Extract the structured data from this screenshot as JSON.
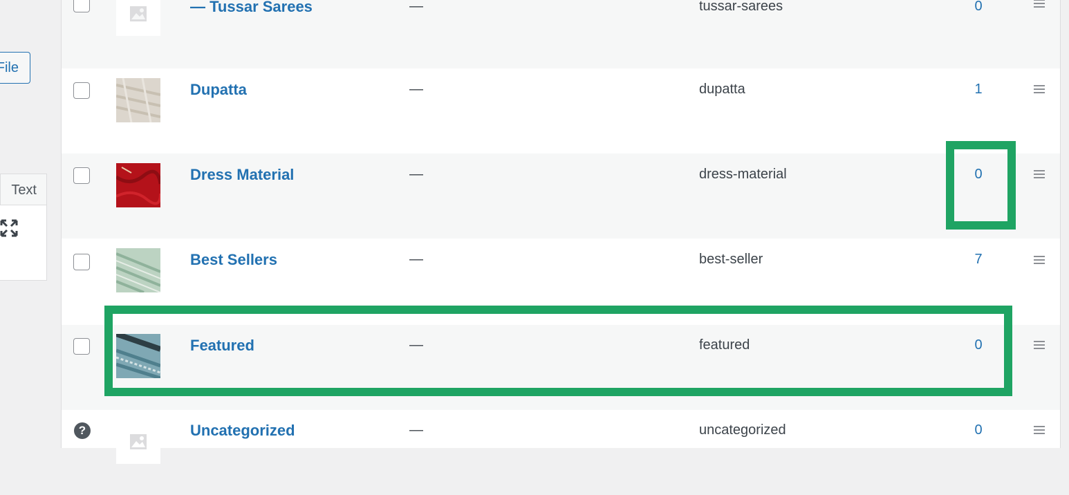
{
  "sidebar": {
    "file_button_label": "File",
    "text_tab_label": "Text"
  },
  "rows": [
    {
      "name": "— Tussar Sarees",
      "description": "—",
      "slug": "tussar-sarees",
      "count": "0"
    },
    {
      "name": "Dupatta",
      "description": "—",
      "slug": "dupatta",
      "count": "1"
    },
    {
      "name": "Dress Material",
      "description": "—",
      "slug": "dress-material",
      "count": "0"
    },
    {
      "name": "Best Sellers",
      "description": "—",
      "slug": "best-seller",
      "count": "7"
    },
    {
      "name": "Featured",
      "description": "—",
      "slug": "featured",
      "count": "0"
    },
    {
      "name": "Uncategorized",
      "description": "—",
      "slug": "uncategorized",
      "count": "0"
    }
  ],
  "colors": {
    "link": "#2271b1",
    "highlight": "#1fa463",
    "alt_row": "#f6f7f7"
  },
  "icons": {
    "placeholder": "image-placeholder-icon",
    "drag": "drag-handle-icon",
    "help": "help-icon",
    "expand": "fullscreen-icon"
  }
}
